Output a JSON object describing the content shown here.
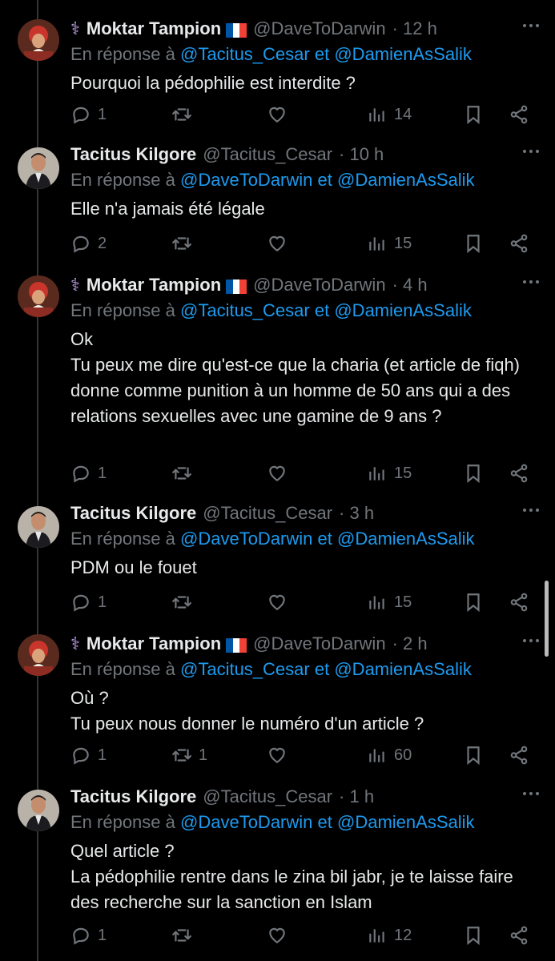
{
  "tweets": [
    {
      "name": "Moktar Tampion",
      "handle": "@DaveToDarwin",
      "time": "· 12 h",
      "reply_prefix": "En réponse à",
      "mention1": "@Tacitus_Cesar",
      "conj": "et",
      "mention2": "@DamienAsSalik",
      "text": "Pourquoi la pédophilie est interdite ?",
      "replies": "1",
      "retweets": "",
      "likes": "",
      "views": "14",
      "verified": true,
      "flag": true
    },
    {
      "name": "Tacitus Kilgore",
      "handle": "@Tacitus_Cesar",
      "time": "· 10 h",
      "reply_prefix": "En réponse à",
      "mention1": "@DaveToDarwin",
      "conj": "et",
      "mention2": "@DamienAsSalik",
      "text": "Elle n'a jamais été légale",
      "replies": "2",
      "retweets": "",
      "likes": "",
      "views": "15",
      "verified": false,
      "flag": false
    },
    {
      "name": "Moktar Tampion",
      "handle": "@DaveToDarwin",
      "time": "· 4 h",
      "reply_prefix": "En réponse à",
      "mention1": "@Tacitus_Cesar",
      "conj": "et",
      "mention2": "@DamienAsSalik",
      "text": "Ok\nTu peux me dire qu'est-ce que la charia (et article de fiqh) donne comme punition à un homme de 50 ans qui a des relations sexuelles avec une gamine de 9 ans ?",
      "replies": "1",
      "retweets": "",
      "likes": "",
      "views": "15",
      "verified": true,
      "flag": true
    },
    {
      "name": "Tacitus Kilgore",
      "handle": "@Tacitus_Cesar",
      "time": "· 3 h",
      "reply_prefix": "En réponse à",
      "mention1": "@DaveToDarwin",
      "conj": "et",
      "mention2": "@DamienAsSalik",
      "text": "PDM ou le fouet",
      "replies": "1",
      "retweets": "",
      "likes": "",
      "views": "15",
      "verified": false,
      "flag": false
    },
    {
      "name": "Moktar Tampion",
      "handle": "@DaveToDarwin",
      "time": "· 2 h",
      "reply_prefix": "En réponse à",
      "mention1": "@Tacitus_Cesar",
      "conj": "et",
      "mention2": "@DamienAsSalik",
      "text": "Où ?\nTu peux nous donner le numéro d'un article ?",
      "replies": "1",
      "retweets": "1",
      "likes": "",
      "views": "60",
      "verified": true,
      "flag": true
    },
    {
      "name": "Tacitus Kilgore",
      "handle": "@Tacitus_Cesar",
      "time": "· 1 h",
      "reply_prefix": "En réponse à",
      "mention1": "@DaveToDarwin",
      "conj": "et",
      "mention2": "@DamienAsSalik",
      "text": "Quel article ?\nLa pédophilie rentre dans le zina bil jabr, je te laisse faire des recherche sur la sanction en Islam",
      "replies": "1",
      "retweets": "",
      "likes": "",
      "views": "12",
      "verified": false,
      "flag": false
    }
  ],
  "colors": {
    "background": "#000000",
    "text": "#e7e9ea",
    "muted": "#71767b",
    "link": "#1d9bf0",
    "thread_line": "#333639"
  },
  "icons": [
    "medical-badge-icon",
    "flag-france-icon",
    "more-icon",
    "reply-icon",
    "retweet-icon",
    "like-icon",
    "views-icon",
    "bookmark-icon",
    "share-icon"
  ]
}
